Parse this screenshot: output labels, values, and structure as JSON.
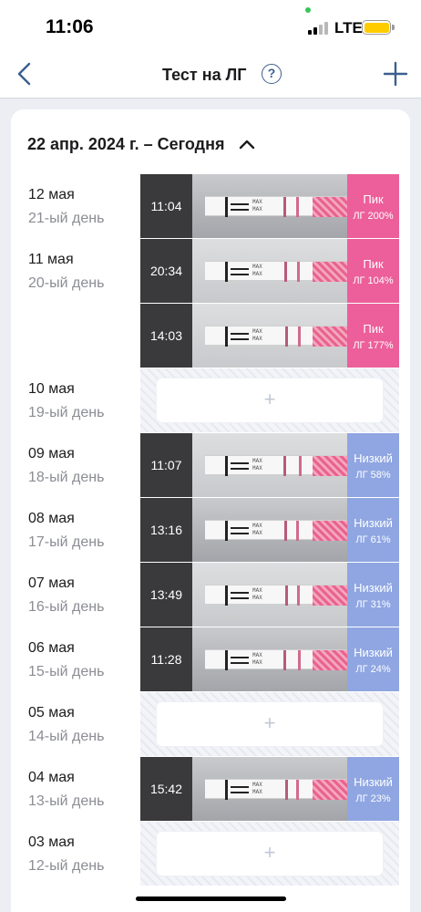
{
  "status_bar": {
    "time": "11:06",
    "network": "LTE"
  },
  "nav": {
    "title": "Тест на ЛГ",
    "help_icon": "help-circle-icon",
    "back_icon": "chevron-left-icon",
    "add_icon": "plus-icon"
  },
  "range": {
    "label": "22 апр. 2024 г. – Сегодня"
  },
  "days": [
    {
      "date": "12 мая",
      "day": "21-ый день",
      "entries": [
        {
          "time": "11:04",
          "level": "Пик",
          "value": "ЛГ 200%",
          "kind": "peak"
        }
      ]
    },
    {
      "date": "11 мая",
      "day": "20-ый день",
      "entries": [
        {
          "time": "20:34",
          "level": "Пик",
          "value": "ЛГ 104%",
          "kind": "peak"
        },
        {
          "time": "14:03",
          "level": "Пик",
          "value": "ЛГ 177%",
          "kind": "peak"
        }
      ]
    },
    {
      "date": "10 мая",
      "day": "19-ый день",
      "entries": [],
      "add_label": "+"
    },
    {
      "date": "09 мая",
      "day": "18-ый день",
      "entries": [
        {
          "time": "11:07",
          "level": "Низкий",
          "value": "ЛГ 58%",
          "kind": "low"
        }
      ]
    },
    {
      "date": "08 мая",
      "day": "17-ый день",
      "entries": [
        {
          "time": "13:16",
          "level": "Низкий",
          "value": "ЛГ 61%",
          "kind": "low"
        }
      ]
    },
    {
      "date": "07 мая",
      "day": "16-ый день",
      "entries": [
        {
          "time": "13:49",
          "level": "Низкий",
          "value": "ЛГ 31%",
          "kind": "low"
        }
      ]
    },
    {
      "date": "06 мая",
      "day": "15-ый день",
      "entries": [
        {
          "time": "11:28",
          "level": "Низкий",
          "value": "ЛГ 24%",
          "kind": "low"
        }
      ]
    },
    {
      "date": "05 мая",
      "day": "14-ый день",
      "entries": [],
      "add_label": "+"
    },
    {
      "date": "04 мая",
      "day": "13-ый день",
      "entries": [
        {
          "time": "15:42",
          "level": "Низкий",
          "value": "ЛГ 23%",
          "kind": "low"
        }
      ]
    },
    {
      "date": "03 мая",
      "day": "12-ый день",
      "entries": [],
      "add_label": "+"
    }
  ],
  "strip_text": "MAX",
  "colors": {
    "peak": "#ec5f9a",
    "low": "#8fa6e2",
    "accent": "#3b5f8f",
    "time_box": "#3a3a3c"
  }
}
